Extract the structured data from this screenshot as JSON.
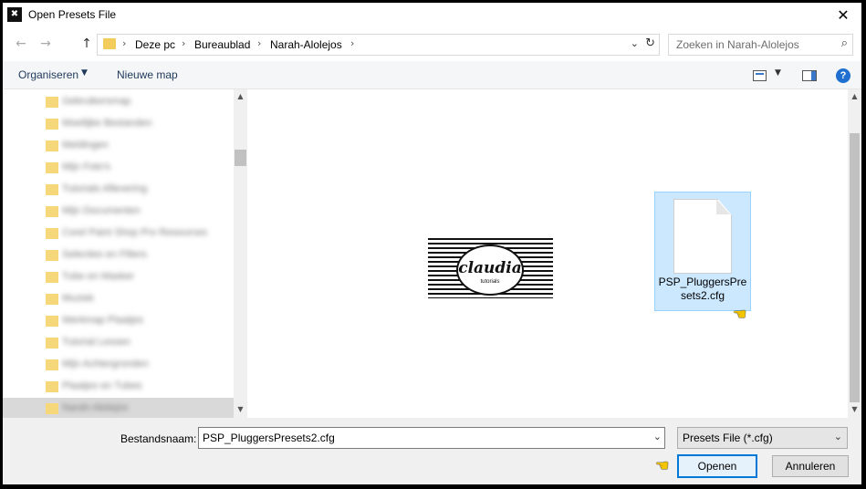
{
  "window": {
    "title": "Open Presets File",
    "app_icon_glyph": "✖",
    "close_glyph": "✕"
  },
  "nav": {
    "back_glyph": "←",
    "forward_glyph": "→",
    "up_glyph": "↑",
    "breadcrumbs": [
      "Deze pc",
      "Bureaublad",
      "Narah-Alolejos"
    ],
    "breadcrumb_sep": "›",
    "dropdown_glyph": "⌄",
    "refresh_glyph": "↻",
    "search_placeholder": "Zoeken in Narah-Alolejos",
    "search_icon_glyph": "⌕"
  },
  "toolbar": {
    "organize_label": "Organiseren",
    "organize_arrow": "▼",
    "new_folder_label": "Nieuwe map",
    "view_dropdown_glyph": "▼",
    "help_glyph": "?"
  },
  "tree": {
    "items": [
      {
        "label": "Gebruikersmap"
      },
      {
        "label": "Moeilijke Bestanden"
      },
      {
        "label": "Meldingen"
      },
      {
        "label": "Mijn Foto's"
      },
      {
        "label": "Tutorials Aflevering"
      },
      {
        "label": "Mijn Documenten"
      },
      {
        "label": "Corel Paint Shop Pro Resources"
      },
      {
        "label": "Selecties en Filters"
      },
      {
        "label": "Tube en Masker"
      },
      {
        "label": "Muziek"
      },
      {
        "label": "Werkmap Plaatjes"
      },
      {
        "label": "Tutorial Lessen"
      },
      {
        "label": "Mijn Achtergronden"
      },
      {
        "label": "Plaatjes en Tubes"
      },
      {
        "label": "Narah-Alolejos"
      }
    ],
    "selected_index": 14,
    "scroll_up_glyph": "▲",
    "scroll_down_glyph": "▼"
  },
  "content": {
    "logo_text": "claudia",
    "logo_subtext": "tutorials",
    "file_name": "PSP_PluggersPresets2.cfg",
    "pointer_glyph": "☚"
  },
  "bottom": {
    "filename_label": "Bestandsnaam:",
    "filename_value": "PSP_PluggersPresets2.cfg",
    "filetype_value": "Presets File (*.cfg)",
    "open_label": "Openen",
    "cancel_label": "Annuleren"
  }
}
